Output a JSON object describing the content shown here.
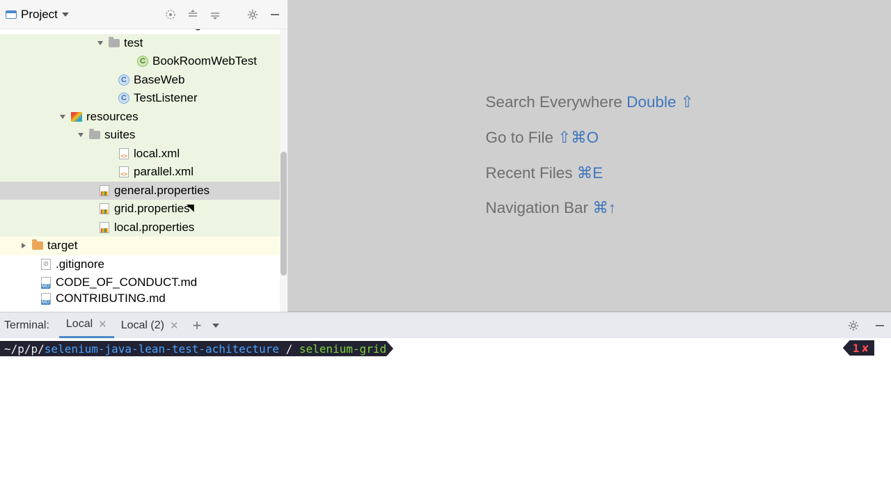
{
  "header": {
    "title": "Project"
  },
  "tree": {
    "items": [
      {
        "label": "com.eliasnogueira",
        "indent": 165,
        "icon": "folder-grey",
        "clipped": true
      },
      {
        "label": "test",
        "indent": 138,
        "icon": "folder-grey",
        "toggle": "open",
        "hl": "pkg"
      },
      {
        "label": "BookRoomWebTest",
        "indent": 195,
        "icon": "c-green",
        "hl": "pkg"
      },
      {
        "label": "BaseWeb",
        "indent": 168,
        "icon": "c-blue",
        "hl": "pkg"
      },
      {
        "label": "TestListener",
        "indent": 168,
        "icon": "c-blue",
        "hl": "pkg"
      },
      {
        "label": "resources",
        "indent": 84,
        "icon": "res",
        "toggle": "open",
        "hl": "pkg"
      },
      {
        "label": "suites",
        "indent": 110,
        "icon": "folder-grey",
        "toggle": "open",
        "hl": "pkg"
      },
      {
        "label": "local.xml",
        "indent": 168,
        "icon": "xml",
        "hl": "pkg"
      },
      {
        "label": "parallel.xml",
        "indent": 168,
        "icon": "xml",
        "hl": "pkg"
      },
      {
        "label": "general.properties",
        "indent": 140,
        "icon": "props",
        "hl": "sel"
      },
      {
        "label": "grid.properties",
        "indent": 140,
        "icon": "props",
        "hl": "pkg"
      },
      {
        "label": "local.properties",
        "indent": 140,
        "icon": "props",
        "hl": "pkg"
      },
      {
        "label": "target",
        "indent": 28,
        "icon": "folder-orange",
        "toggle": "closed",
        "hl": "target"
      },
      {
        "label": ".gitignore",
        "indent": 56,
        "icon": "gi"
      },
      {
        "label": "CODE_OF_CONDUCT.md",
        "indent": 56,
        "icon": "md"
      },
      {
        "label": "CONTRIBUTING.md",
        "indent": 56,
        "icon": "md",
        "clipped_bottom": true
      }
    ]
  },
  "editor_hints": [
    {
      "label": "Search Everywhere",
      "kbd": "Double ⇧"
    },
    {
      "label": "Go to File",
      "kbd": "⇧⌘O"
    },
    {
      "label": "Recent Files",
      "kbd": "⌘E"
    },
    {
      "label": "Navigation Bar",
      "kbd": "⌘↑"
    }
  ],
  "terminal": {
    "label": "Terminal:",
    "tabs": [
      {
        "name": "Local",
        "active": true
      },
      {
        "name": "Local (2)",
        "active": false
      }
    ],
    "prompt": {
      "prefix": "~/p/p/",
      "path": "selenium-java-lean-test-achitecture",
      "branch_sep": " / ",
      "branch": "selenium-grid"
    },
    "right_chip": {
      "num": "1",
      "sym": "✘"
    }
  }
}
